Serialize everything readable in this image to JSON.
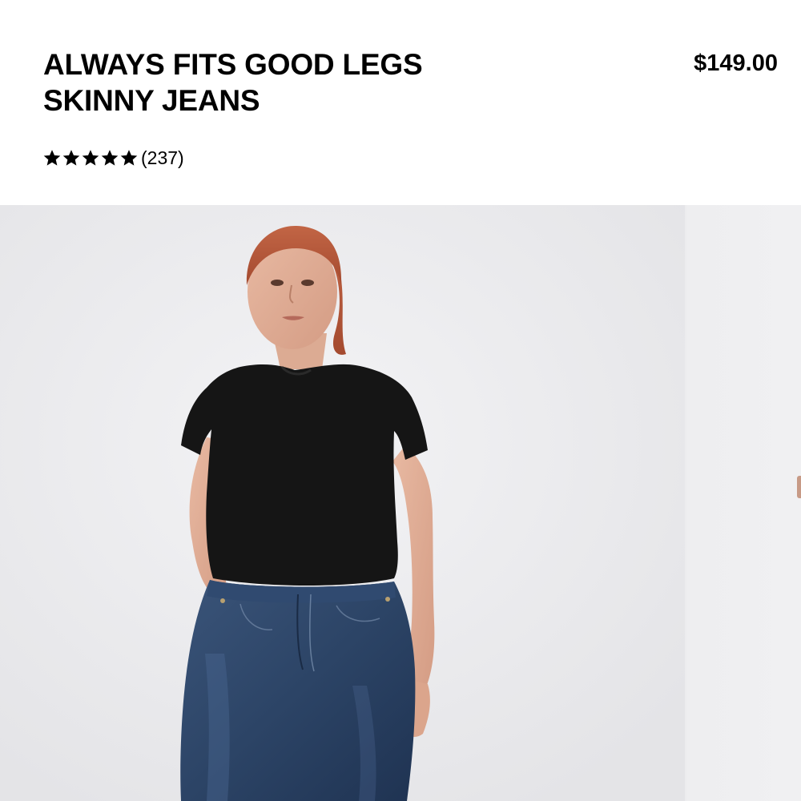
{
  "product": {
    "title_line1": "ALWAYS FITS GOOD LEGS",
    "title_line2": "SKINNY JEANS",
    "price": "$149.00",
    "rating": {
      "stars": 5,
      "review_count": "(237)"
    }
  },
  "gallery": {
    "slides": [
      {
        "subject": "model wearing black crop t-shirt and dark blue skinny jeans"
      },
      {
        "subject": "next product photo (partially visible)"
      }
    ]
  },
  "colors": {
    "text": "#000000",
    "background": "#ffffff",
    "photo_background": "#ececee",
    "tshirt": "#141414",
    "denim": "#2e4668",
    "hair": "#b9573a"
  },
  "icons": {
    "rating_star": "star-icon"
  }
}
